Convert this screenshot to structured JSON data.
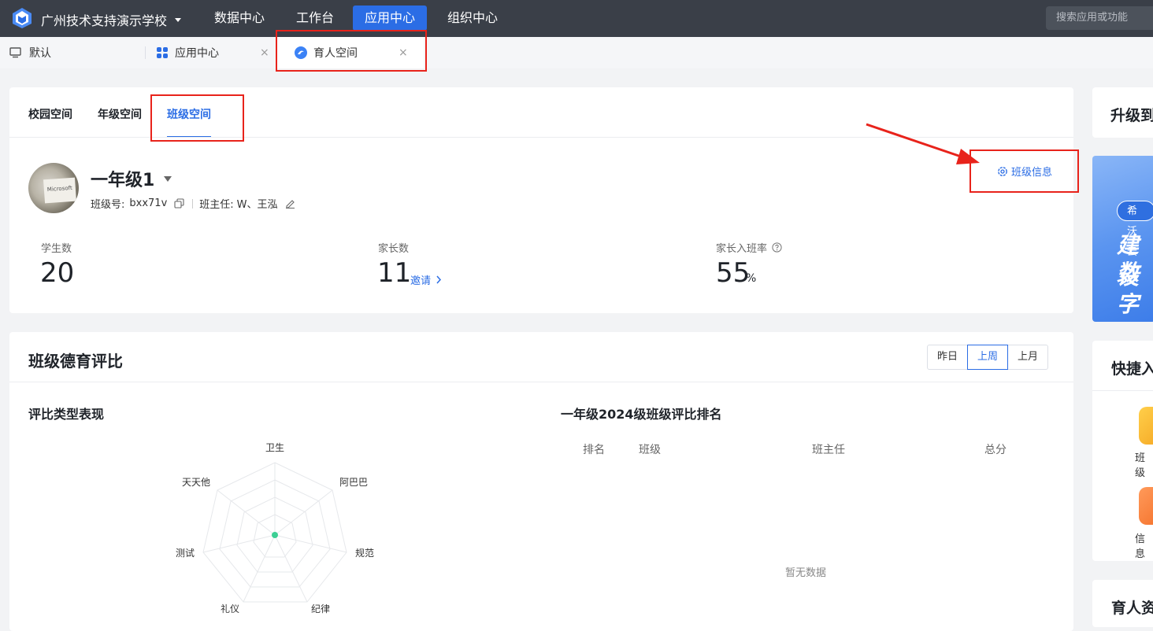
{
  "topbar": {
    "school_name": "广州技术支持演示学校",
    "nav": [
      "数据中心",
      "工作台",
      "应用中心",
      "组织中心"
    ],
    "active_nav": "应用中心",
    "search_placeholder": "搜索应用或功能",
    "accent": "#2b6de5"
  },
  "tabs": [
    {
      "label": "默认",
      "icon": "monitor-icon"
    },
    {
      "label": "应用中心",
      "icon": "apps-grid-icon",
      "close": "×"
    },
    {
      "label": "育人空间",
      "icon": "yuren-icon",
      "close": "×",
      "active": true
    }
  ],
  "subtabs": [
    "校园空间",
    "年级空间",
    "班级空间"
  ],
  "active_subtab": "班级空间",
  "class": {
    "name": "一年级1",
    "code_label": "班级号:",
    "code": "bxx71v",
    "teacher_label": "班主任:",
    "teacher": "W、王泓",
    "info_button": "班级信息",
    "avatar_text": "Microsoft"
  },
  "stats": {
    "students_label": "学生数",
    "students": "20",
    "parents_label": "家长数",
    "parents": "11",
    "invite": "邀请",
    "rate_label": "家长入班率",
    "rate": "55",
    "rate_unit": "%"
  },
  "moral": {
    "title": "班级德育评比",
    "ranges": [
      "昨日",
      "上周",
      "上月"
    ],
    "selected_range": "上周",
    "radar_title": "评比类型表现",
    "radar_axes": [
      "卫生",
      "阿巴巴",
      "规范",
      "纪律",
      "礼仪",
      "测试",
      "天天他"
    ],
    "rank_title": "一年级2024级班级评比排名",
    "rank_headers": [
      "排名",
      "班级",
      "班主任",
      "总分"
    ],
    "empty": "暂无数据"
  },
  "right": {
    "upgrade_title": "升级到",
    "banner_pill": "希沃云",
    "banner_line1": "建设",
    "banner_line2": "数字",
    "shortcut_title": "快捷入",
    "app1": "班级",
    "app2": "信息",
    "resource_title": "育人资"
  }
}
